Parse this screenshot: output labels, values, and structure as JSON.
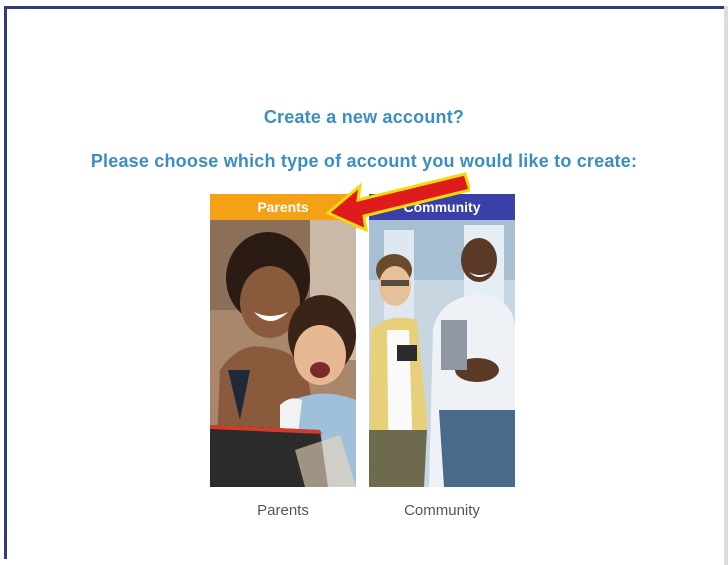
{
  "heading": {
    "question": "Create a new account?",
    "instruction": "Please choose which type of account you would like to create:"
  },
  "cards": [
    {
      "banner": "Parents",
      "caption": "Parents",
      "banner_color": "#f5a115"
    },
    {
      "banner": "Community",
      "caption": "Community",
      "banner_color": "#3b3fa8"
    }
  ],
  "colors": {
    "heading": "#3a8fc2",
    "frame": "#2f3d7a",
    "arrow_fill": "#e01b1b",
    "arrow_outline": "#f5d90a"
  }
}
